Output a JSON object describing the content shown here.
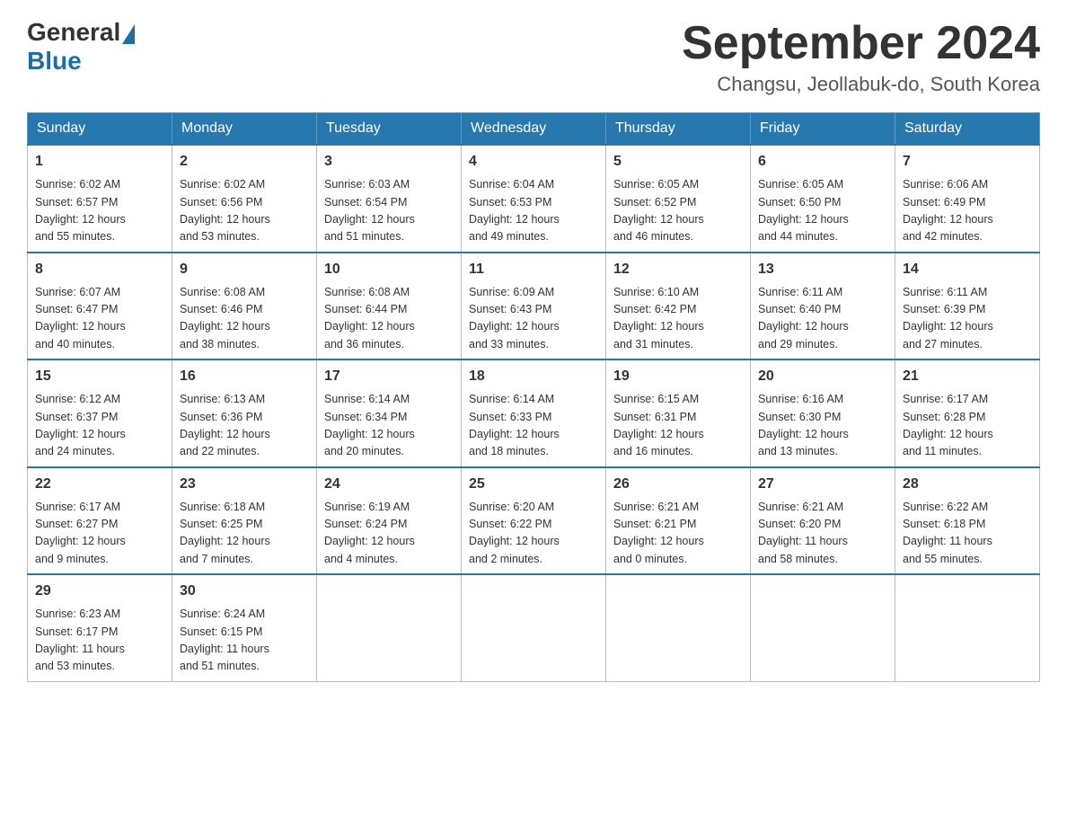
{
  "header": {
    "logo_general": "General",
    "logo_blue": "Blue",
    "month_title": "September 2024",
    "location": "Changsu, Jeollabuk-do, South Korea"
  },
  "days_of_week": [
    "Sunday",
    "Monday",
    "Tuesday",
    "Wednesday",
    "Thursday",
    "Friday",
    "Saturday"
  ],
  "weeks": [
    [
      {
        "day": "1",
        "sunrise": "6:02 AM",
        "sunset": "6:57 PM",
        "daylight": "12 hours and 55 minutes."
      },
      {
        "day": "2",
        "sunrise": "6:02 AM",
        "sunset": "6:56 PM",
        "daylight": "12 hours and 53 minutes."
      },
      {
        "day": "3",
        "sunrise": "6:03 AM",
        "sunset": "6:54 PM",
        "daylight": "12 hours and 51 minutes."
      },
      {
        "day": "4",
        "sunrise": "6:04 AM",
        "sunset": "6:53 PM",
        "daylight": "12 hours and 49 minutes."
      },
      {
        "day": "5",
        "sunrise": "6:05 AM",
        "sunset": "6:52 PM",
        "daylight": "12 hours and 46 minutes."
      },
      {
        "day": "6",
        "sunrise": "6:05 AM",
        "sunset": "6:50 PM",
        "daylight": "12 hours and 44 minutes."
      },
      {
        "day": "7",
        "sunrise": "6:06 AM",
        "sunset": "6:49 PM",
        "daylight": "12 hours and 42 minutes."
      }
    ],
    [
      {
        "day": "8",
        "sunrise": "6:07 AM",
        "sunset": "6:47 PM",
        "daylight": "12 hours and 40 minutes."
      },
      {
        "day": "9",
        "sunrise": "6:08 AM",
        "sunset": "6:46 PM",
        "daylight": "12 hours and 38 minutes."
      },
      {
        "day": "10",
        "sunrise": "6:08 AM",
        "sunset": "6:44 PM",
        "daylight": "12 hours and 36 minutes."
      },
      {
        "day": "11",
        "sunrise": "6:09 AM",
        "sunset": "6:43 PM",
        "daylight": "12 hours and 33 minutes."
      },
      {
        "day": "12",
        "sunrise": "6:10 AM",
        "sunset": "6:42 PM",
        "daylight": "12 hours and 31 minutes."
      },
      {
        "day": "13",
        "sunrise": "6:11 AM",
        "sunset": "6:40 PM",
        "daylight": "12 hours and 29 minutes."
      },
      {
        "day": "14",
        "sunrise": "6:11 AM",
        "sunset": "6:39 PM",
        "daylight": "12 hours and 27 minutes."
      }
    ],
    [
      {
        "day": "15",
        "sunrise": "6:12 AM",
        "sunset": "6:37 PM",
        "daylight": "12 hours and 24 minutes."
      },
      {
        "day": "16",
        "sunrise": "6:13 AM",
        "sunset": "6:36 PM",
        "daylight": "12 hours and 22 minutes."
      },
      {
        "day": "17",
        "sunrise": "6:14 AM",
        "sunset": "6:34 PM",
        "daylight": "12 hours and 20 minutes."
      },
      {
        "day": "18",
        "sunrise": "6:14 AM",
        "sunset": "6:33 PM",
        "daylight": "12 hours and 18 minutes."
      },
      {
        "day": "19",
        "sunrise": "6:15 AM",
        "sunset": "6:31 PM",
        "daylight": "12 hours and 16 minutes."
      },
      {
        "day": "20",
        "sunrise": "6:16 AM",
        "sunset": "6:30 PM",
        "daylight": "12 hours and 13 minutes."
      },
      {
        "day": "21",
        "sunrise": "6:17 AM",
        "sunset": "6:28 PM",
        "daylight": "12 hours and 11 minutes."
      }
    ],
    [
      {
        "day": "22",
        "sunrise": "6:17 AM",
        "sunset": "6:27 PM",
        "daylight": "12 hours and 9 minutes."
      },
      {
        "day": "23",
        "sunrise": "6:18 AM",
        "sunset": "6:25 PM",
        "daylight": "12 hours and 7 minutes."
      },
      {
        "day": "24",
        "sunrise": "6:19 AM",
        "sunset": "6:24 PM",
        "daylight": "12 hours and 4 minutes."
      },
      {
        "day": "25",
        "sunrise": "6:20 AM",
        "sunset": "6:22 PM",
        "daylight": "12 hours and 2 minutes."
      },
      {
        "day": "26",
        "sunrise": "6:21 AM",
        "sunset": "6:21 PM",
        "daylight": "12 hours and 0 minutes."
      },
      {
        "day": "27",
        "sunrise": "6:21 AM",
        "sunset": "6:20 PM",
        "daylight": "11 hours and 58 minutes."
      },
      {
        "day": "28",
        "sunrise": "6:22 AM",
        "sunset": "6:18 PM",
        "daylight": "11 hours and 55 minutes."
      }
    ],
    [
      {
        "day": "29",
        "sunrise": "6:23 AM",
        "sunset": "6:17 PM",
        "daylight": "11 hours and 53 minutes."
      },
      {
        "day": "30",
        "sunrise": "6:24 AM",
        "sunset": "6:15 PM",
        "daylight": "11 hours and 51 minutes."
      },
      null,
      null,
      null,
      null,
      null
    ]
  ],
  "labels": {
    "sunrise": "Sunrise:",
    "sunset": "Sunset:",
    "daylight": "Daylight:"
  }
}
